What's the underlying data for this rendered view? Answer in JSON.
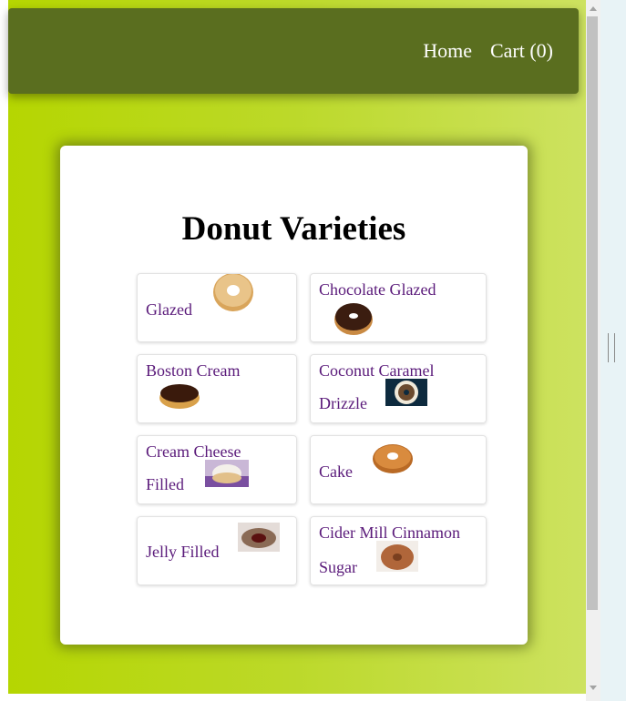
{
  "nav": {
    "home_label": "Home",
    "cart_label": "Cart (0)"
  },
  "page": {
    "title": "Donut Varieties"
  },
  "donuts": [
    {
      "name": "Glazed",
      "image_icon": "glazed-donut-icon"
    },
    {
      "name": "Chocolate Glazed",
      "image_icon": "chocolate-glazed-donut-icon"
    },
    {
      "name": "Boston Cream",
      "image_icon": "boston-cream-donut-icon"
    },
    {
      "name": "Coconut Caramel Drizzle",
      "image_icon": "coconut-caramel-donut-icon"
    },
    {
      "name": "Cream Cheese Filled",
      "image_icon": "cream-cheese-donut-icon"
    },
    {
      "name": "Cake",
      "image_icon": "cake-donut-icon"
    },
    {
      "name": "Jelly Filled",
      "image_icon": "jelly-filled-donut-icon"
    },
    {
      "name": "Cider Mill Cinnamon Sugar",
      "image_icon": "cinnamon-sugar-donut-icon"
    }
  ],
  "colors": {
    "header": "#5a6e1f",
    "background_start": "#b5d600",
    "background_end": "#cde260",
    "link": "#5a1a7a"
  }
}
